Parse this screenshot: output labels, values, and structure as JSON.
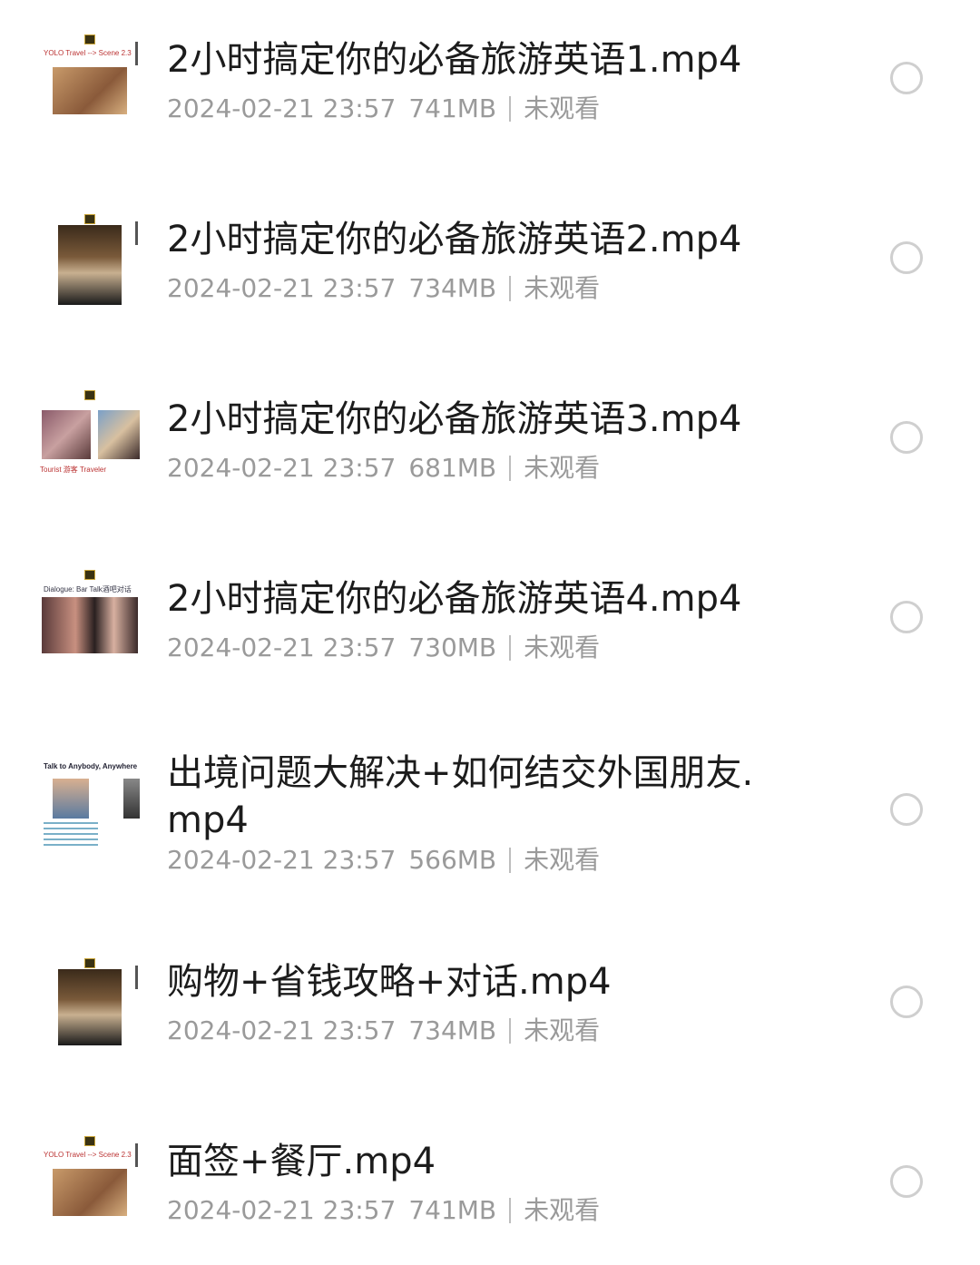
{
  "files": [
    {
      "name": "2小时搞定你的必备旅游英语1.mp4",
      "date": "2024-02-21 23:57",
      "size": "741MB",
      "status": "未观看",
      "thumbnail": {
        "caption": "YOLO Travel --> Scene 2.3",
        "icon": "video-thumbnail-icon",
        "tint": "#b07a4a"
      }
    },
    {
      "name": "2小时搞定你的必备旅游英语2.mp4",
      "date": "2024-02-21 23:57",
      "size": "734MB",
      "status": "未观看",
      "thumbnail": {
        "caption": "",
        "icon": "video-thumbnail-icon",
        "tint": "#6b4a2e"
      }
    },
    {
      "name": "2小时搞定你的必备旅游英语3.mp4",
      "date": "2024-02-21 23:57",
      "size": "681MB",
      "status": "未观看",
      "thumbnail": {
        "caption": "Tourist 游客      Traveler",
        "icon": "video-thumbnail-icon",
        "tint": "#7a5a60"
      }
    },
    {
      "name": "2小时搞定你的必备旅游英语4.mp4",
      "date": "2024-02-21 23:57",
      "size": "730MB",
      "status": "未观看",
      "thumbnail": {
        "caption": "Dialogue: Bar Talk酒吧对话",
        "icon": "video-thumbnail-icon",
        "tint": "#5a3a3a"
      }
    },
    {
      "name": "出境问题大解决+如何结交外国朋友.mp4",
      "date": "2024-02-21 23:57",
      "size": "566MB",
      "status": "未观看",
      "thumbnail": {
        "caption": "Talk to Anybody, Anywhere",
        "icon": "video-thumbnail-icon",
        "tint": "#8aa0b0"
      }
    },
    {
      "name": "购物+省钱攻略+对话.mp4",
      "date": "2024-02-21 23:57",
      "size": "734MB",
      "status": "未观看",
      "thumbnail": {
        "caption": "",
        "icon": "video-thumbnail-icon",
        "tint": "#6b4a2e"
      }
    },
    {
      "name": "面签+餐厅.mp4",
      "date": "2024-02-21 23:57",
      "size": "741MB",
      "status": "未观看",
      "thumbnail": {
        "caption": "YOLO Travel --> Scene 2.3",
        "icon": "video-thumbnail-icon",
        "tint": "#b07a4a"
      }
    }
  ],
  "selection_icon": "radio-unchecked-icon"
}
